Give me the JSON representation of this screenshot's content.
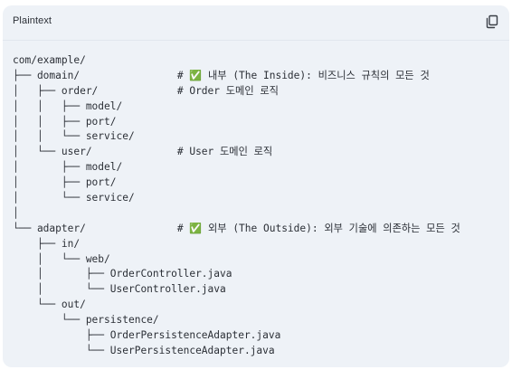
{
  "code_block": {
    "language": "Plaintext",
    "copy_icon": "copy-icon",
    "lines": [
      "com/example/",
      "├── domain/                # ✅ 내부 (The Inside): 비즈니스 규칙의 모든 것",
      "│   ├── order/             # Order 도메인 로직",
      "│   │   ├── model/",
      "│   │   ├── port/",
      "│   │   └── service/",
      "│   └── user/              # User 도메인 로직",
      "│       ├── model/",
      "│       ├── port/",
      "│       └── service/",
      "│",
      "└── adapter/               # ✅ 외부 (The Outside): 외부 기술에 의존하는 모든 것",
      "    ├── in/",
      "    │   └── web/",
      "    │       ├── OrderController.java",
      "    │       └── UserController.java",
      "    └── out/",
      "        └── persistence/",
      "            ├── OrderPersistenceAdapter.java",
      "            └── UserPersistenceAdapter.java"
    ]
  }
}
